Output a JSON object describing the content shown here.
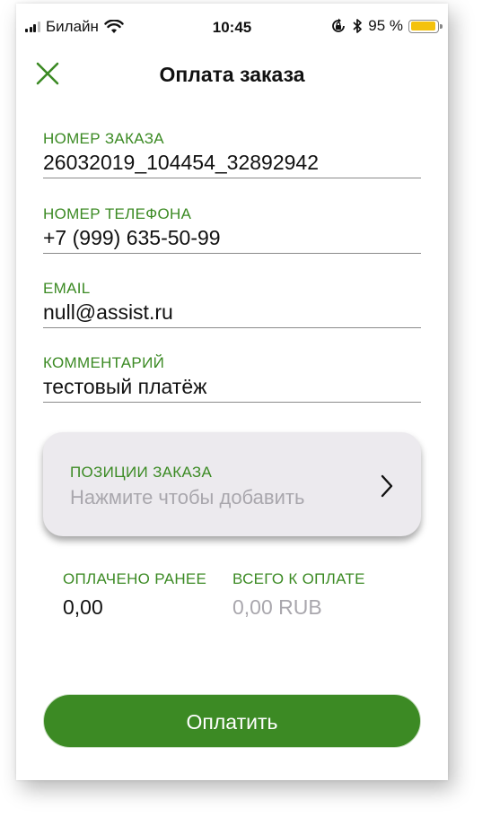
{
  "status_bar": {
    "carrier": "Билайн",
    "time": "10:45",
    "battery_percent": "95 %",
    "battery_level": 0.95,
    "signal_bars": 3,
    "icons": [
      "signal-icon",
      "wifi-icon",
      "rotation-lock-icon",
      "bluetooth-icon",
      "battery-icon"
    ]
  },
  "header": {
    "title": "Оплата заказа",
    "close_icon": "close-icon"
  },
  "form": {
    "order_number": {
      "label": "НОМЕР ЗАКАЗА",
      "value": "26032019_104454_32892942"
    },
    "phone": {
      "label": "НОМЕР ТЕЛЕФОНА",
      "value": "+7 (999) 635-50-99"
    },
    "email": {
      "label": "EMAIL",
      "value": "null@assist.ru"
    },
    "comment": {
      "label": "КОММЕНТАРИЙ",
      "value": "тестовый платёж"
    }
  },
  "positions": {
    "label": "ПОЗИЦИИ ЗАКАЗА",
    "hint": "Нажмите чтобы добавить",
    "icon": "chevron-right-icon"
  },
  "totals": {
    "paid_label": "ОПЛАЧЕНО РАНЕЕ",
    "paid_value": "0,00",
    "total_label": "ВСЕГО К ОПЛАТЕ",
    "total_value": "0,00 RUB"
  },
  "pay_button": {
    "label": "Оплатить"
  },
  "colors": {
    "accent": "#3b8a23",
    "button": "#3c8a24",
    "hint": "#a9a7ad",
    "card_bg": "#eceaee",
    "battery": "#f4c20d"
  }
}
